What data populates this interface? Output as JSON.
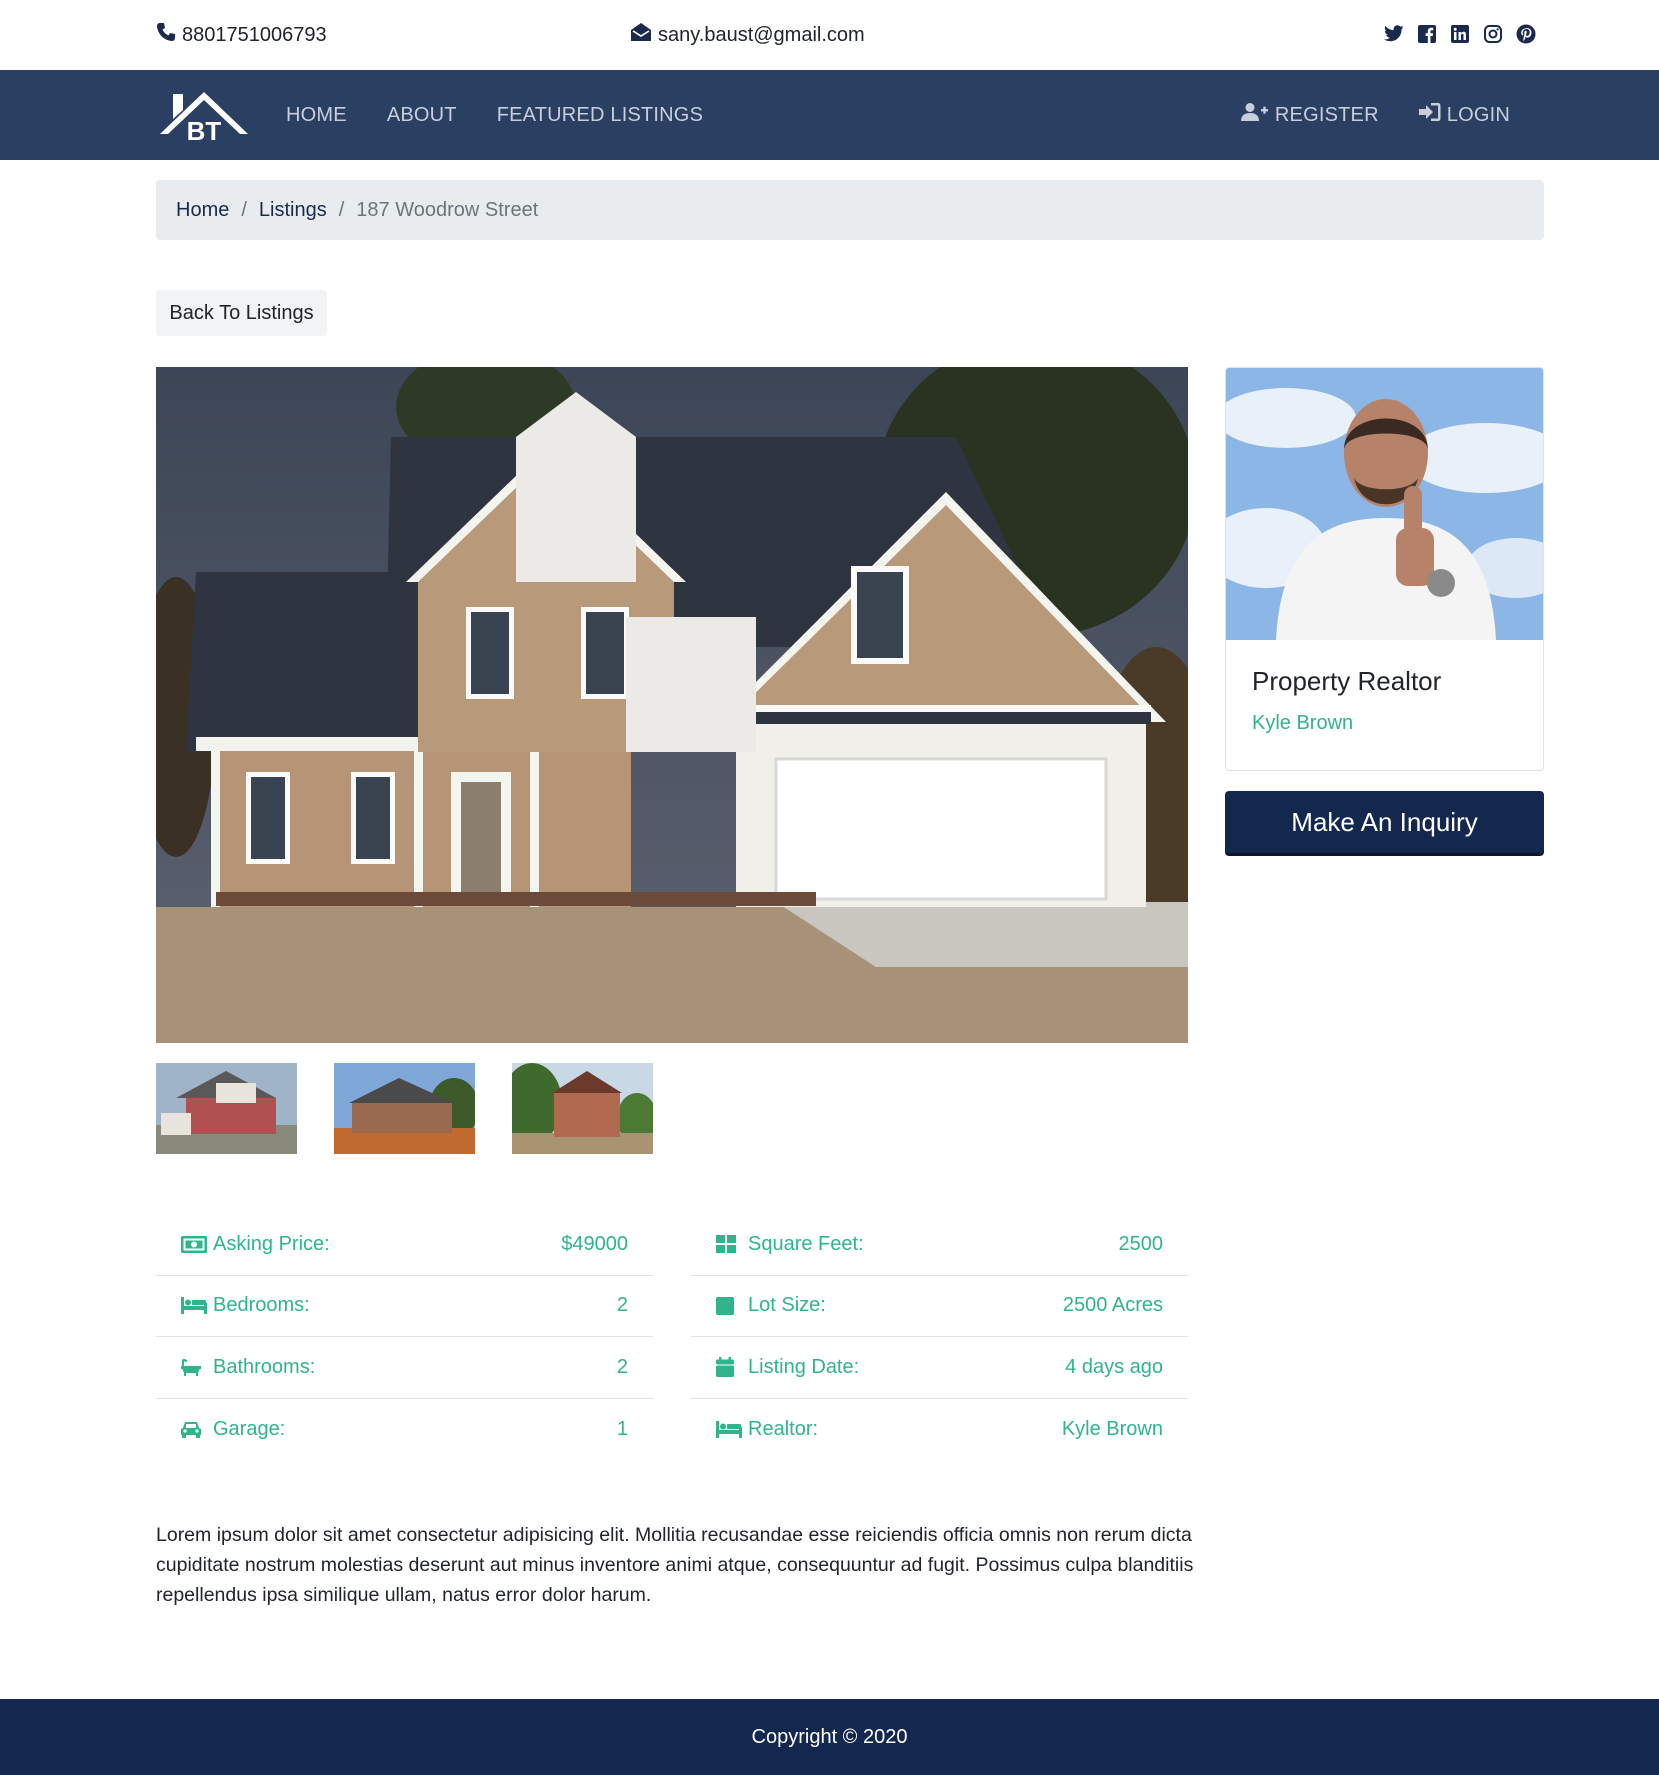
{
  "topbar": {
    "phone": "8801751006793",
    "email": "sany.baust@gmail.com",
    "social_icons": [
      "twitter-icon",
      "facebook-icon",
      "linkedin-icon",
      "instagram-icon",
      "pinterest-icon"
    ]
  },
  "navbar": {
    "logo_text": "BT",
    "links": [
      "HOME",
      "ABOUT",
      "FEATURED LISTINGS"
    ],
    "register_label": "REGISTER",
    "login_label": "LOGIN"
  },
  "breadcrumb": {
    "home": "Home",
    "listings": "Listings",
    "current": "187 Woodrow Street",
    "separator": "/"
  },
  "back_label": "Back To Listings",
  "realtor": {
    "title": "Property Realtor",
    "name": "Kyle Brown"
  },
  "inquiry_label": "Make An Inquiry",
  "details_left": [
    {
      "icon": "money-icon",
      "label": "Asking Price:",
      "value": "$49000"
    },
    {
      "icon": "bed-icon",
      "label": "Bedrooms:",
      "value": "2"
    },
    {
      "icon": "bath-icon",
      "label": "Bathrooms:",
      "value": "2"
    },
    {
      "icon": "car-icon",
      "label": "Garage:",
      "value": "1"
    }
  ],
  "details_right": [
    {
      "icon": "grid-icon",
      "label": "Square Feet:",
      "value": "2500"
    },
    {
      "icon": "square-icon",
      "label": "Lot Size:",
      "value": "2500 Acres"
    },
    {
      "icon": "calendar-icon",
      "label": "Listing Date:",
      "value": "4 days ago"
    },
    {
      "icon": "bed-icon",
      "label": "Realtor:",
      "value": "Kyle Brown"
    }
  ],
  "description": "Lorem ipsum dolor sit amet consectetur adipisicing elit. Mollitia recusandae esse reiciendis officia omnis non rerum dicta cupiditate nostrum molestias deserunt aut minus inventore animi atque, consequuntur ad fugit. Possimus culpa blanditiis repellendus ipsa similique ullam, natus error dolor harum.",
  "footer": "Copyright © 2020",
  "colors": {
    "navbar": "#2b3f62",
    "footer": "#13274f",
    "accent": "#2fb48c",
    "button": "#13274f"
  }
}
